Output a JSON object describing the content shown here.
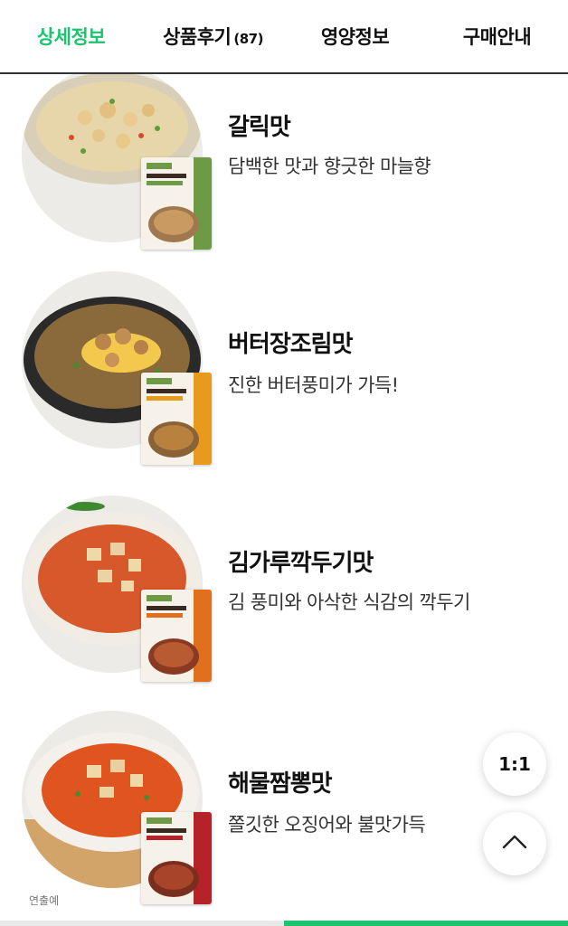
{
  "tabs": [
    {
      "label": "상세정보",
      "active": true
    },
    {
      "label": "상품후기",
      "count": "(87)",
      "active": false
    },
    {
      "label": "영양정보",
      "active": false
    },
    {
      "label": "구매안내",
      "active": false
    }
  ],
  "items": [
    {
      "title": "갈릭맛",
      "desc": "담백한 맛과 향긋한 마늘향",
      "pack_color": "#6f9a45"
    },
    {
      "title": "버터장조림맛",
      "desc": "진한 버터풍미가 가득!",
      "pack_color": "#e89a1c"
    },
    {
      "title": "김가루깍두기맛",
      "desc": "김 풍미와 아삭한 식감의 깍두기",
      "pack_color": "#e0701e"
    },
    {
      "title": "해물짬뽕맛",
      "desc": "쫄깃한 오징어와 불맛가득",
      "pack_color": "#b6222a"
    }
  ],
  "caption": "연출예",
  "fab": {
    "ratio_label": "1:1",
    "top_icon": "chevron-up-icon"
  },
  "progress": {
    "fraction": 0.5,
    "color": "#1ec36f"
  },
  "colors": {
    "accent": "#1ec36f"
  }
}
